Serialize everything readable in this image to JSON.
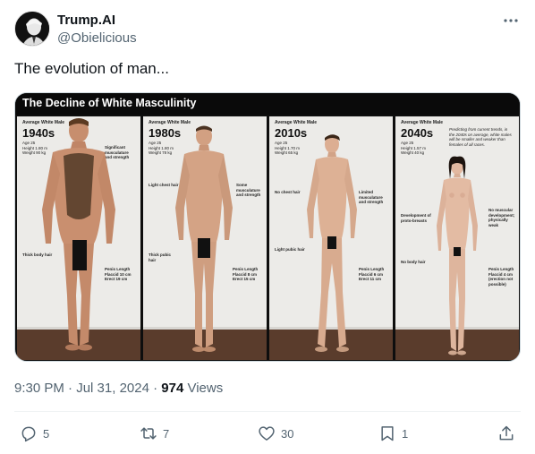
{
  "author": {
    "display_name": "Trump.AI",
    "handle": "@Obielicious"
  },
  "tweet": {
    "text": "The evolution of man..."
  },
  "media": {
    "title": "The Decline of White Masculinity",
    "panels": [
      {
        "avg": "Average White Male",
        "era": "1940s",
        "stats": [
          "Age 25",
          "Height 1.80 m",
          "Weight 90 kg"
        ],
        "notes": [
          {
            "text": "Significant musculature and strength"
          },
          {
            "text": "Thick body hair"
          },
          {
            "text": "Penis Length Flaccid 10 cm Erect 19 cm"
          }
        ]
      },
      {
        "avg": "Average White Male",
        "era": "1980s",
        "stats": [
          "Age 25",
          "Height 1.80 m",
          "Weight 78 kg"
        ],
        "notes": [
          {
            "text": "Light chest hair"
          },
          {
            "text": "Some musculature and strength"
          },
          {
            "text": "Thick pubic hair"
          },
          {
            "text": "Penis Length Flaccid 8 cm Erect 15 cm"
          }
        ]
      },
      {
        "avg": "Average White Male",
        "era": "2010s",
        "stats": [
          "Age 25",
          "Height 1.70 m",
          "Weight 65 kg"
        ],
        "notes": [
          {
            "text": "No chest hair"
          },
          {
            "text": "Limited musculature and strength"
          },
          {
            "text": "Light pubic hair"
          },
          {
            "text": "Penis Length Flaccid 6 cm Erect 11 cm"
          }
        ]
      },
      {
        "avg": "Average White Male",
        "era": "2040s",
        "stats": [
          "Age 25",
          "Height 1.57 m",
          "Weight 40 kg"
        ],
        "notes": [
          {
            "text": "Predicting from current trends, in the 2040s on average, white males will be smaller and weaker than females of all races."
          },
          {
            "text": "Development of proto-breasts"
          },
          {
            "text": "No muscular development; physically weak"
          },
          {
            "text": "No body hair"
          },
          {
            "text": "Penis Length Flaccid 4 cm (erection not possible)"
          }
        ]
      }
    ]
  },
  "meta": {
    "time": "9:30 PM",
    "sep1": " · ",
    "date": "Jul 31, 2024",
    "sep2": " · ",
    "views_count": "974",
    "views_label": " Views"
  },
  "actions": {
    "replies": "5",
    "reposts": "7",
    "likes": "30",
    "bookmarks": "1"
  },
  "icons": [
    "avatar",
    "more-icon",
    "reply-icon",
    "repost-icon",
    "like-icon",
    "bookmark-icon",
    "share-icon"
  ]
}
